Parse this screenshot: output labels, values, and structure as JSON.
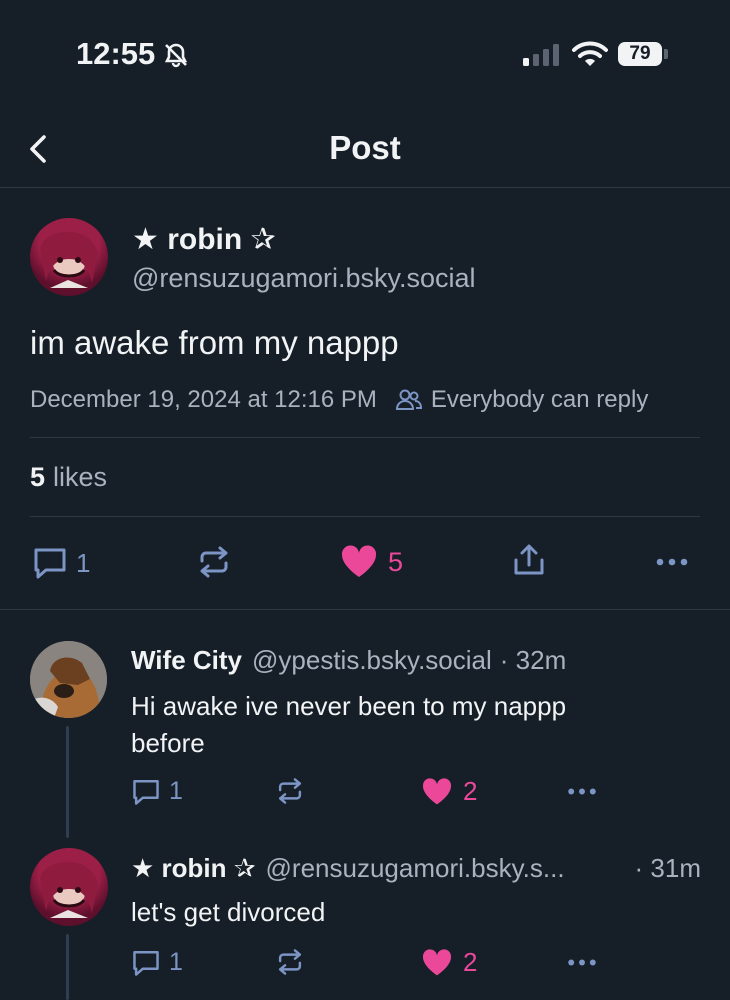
{
  "status_bar": {
    "time": "12:55",
    "battery": "79"
  },
  "header": {
    "title": "Post"
  },
  "post": {
    "display_name": "★ robin ✰",
    "handle": "@rensuzugamori.bsky.social",
    "text": "im awake from my nappp",
    "timestamp": "December 19, 2024 at 12:16 PM",
    "reply_setting": "Everybody can reply",
    "likes_count": "5",
    "likes_label": "likes",
    "actions": {
      "replies": "1",
      "likes": "5"
    }
  },
  "replies": [
    {
      "display_name": "Wife City",
      "handle": "@ypestis.bsky.social",
      "time": "· 32m",
      "text_line1": "Hi awake ive never been to my nappp",
      "text_line2": "before",
      "replies": "1",
      "likes": "2"
    },
    {
      "display_name": "★ robin ✰",
      "handle": "@rensuzugamori.bsky.s...",
      "time": "· 31m",
      "text_line1": "let's get divorced",
      "replies": "1",
      "likes": "2"
    }
  ],
  "colors": {
    "background": "#161e27",
    "accent_pink": "#ec4899",
    "muted": "#a9b3bf"
  }
}
